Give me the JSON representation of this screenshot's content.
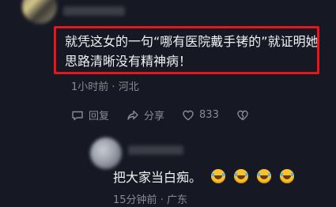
{
  "comment": {
    "text": "就凭这女的一句“哪有医院戴手铐的”就证明她思路清晰没有精神病！",
    "time": "1小时前",
    "location": "河北",
    "actions": {
      "reply_label": "回复",
      "share_label": "分享",
      "like_count": "833"
    },
    "highlight_color": "#e8151b"
  },
  "reply": {
    "text": "把大家当白痴。",
    "emoji_count": 4,
    "emoji_name": "laugh-cry-emoji",
    "time": "15分钟前",
    "location": "广东"
  },
  "icons": [
    "reply-icon",
    "share-icon",
    "like-icon",
    "dislike-icon"
  ],
  "colors": {
    "background": "#161823",
    "text": "#f2f2f4",
    "muted": "#8a8b91"
  }
}
